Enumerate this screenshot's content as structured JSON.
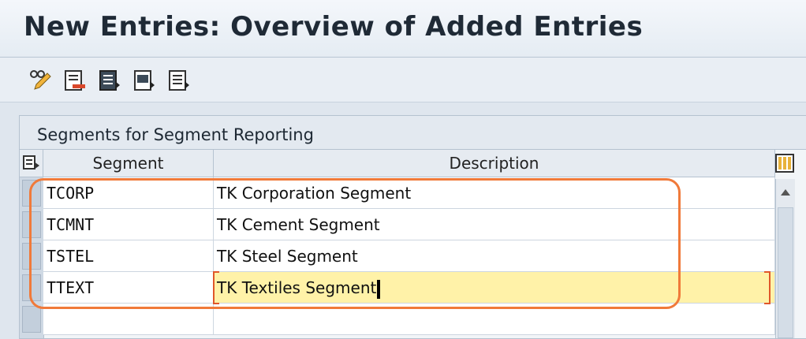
{
  "window": {
    "title": "New Entries: Overview of Added Entries"
  },
  "toolbar": {
    "buttons": [
      {
        "icon": "pencil-glasses-icon",
        "tooltip": "Display/Change"
      },
      {
        "icon": "delete-row-icon",
        "tooltip": "Delete"
      },
      {
        "icon": "select-all-icon",
        "tooltip": "Select All"
      },
      {
        "icon": "select-block-icon",
        "tooltip": "Select Block"
      },
      {
        "icon": "deselect-all-icon",
        "tooltip": "Deselect All"
      }
    ]
  },
  "table": {
    "title": "Segments for Segment Reporting",
    "columns": [
      "Segment",
      "Description"
    ],
    "rows": [
      {
        "segment": "TCORP",
        "description": "TK Corporation Segment"
      },
      {
        "segment": "TCMNT",
        "description": "TK Cement Segment"
      },
      {
        "segment": "TSTEL",
        "description": "TK Steel Segment"
      },
      {
        "segment": "TTEXT",
        "description": "TK Textiles Segment"
      },
      {
        "segment": "",
        "description": ""
      }
    ],
    "active_row": 3
  },
  "colors": {
    "highlight": "#f07a3a",
    "active_cell": "#fff2a8"
  }
}
